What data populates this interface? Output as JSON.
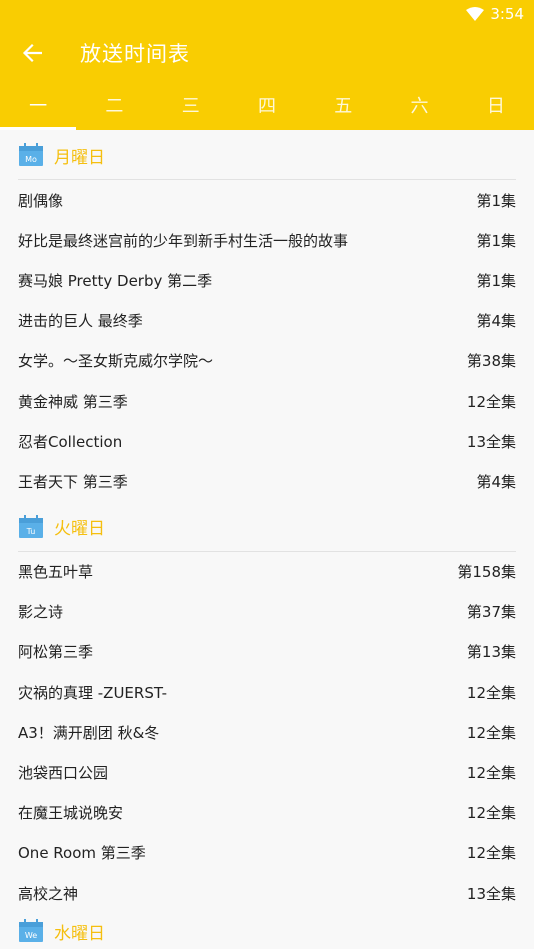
{
  "status": {
    "time": "3:54"
  },
  "toolbar": {
    "title": "放送时间表"
  },
  "tabs": [
    "一",
    "二",
    "三",
    "四",
    "五",
    "六",
    "日"
  ],
  "colors": {
    "appbar": "#f9cd02",
    "section_title": "#f5bf0f",
    "calendar": "#5ab0e8"
  },
  "sections": [
    {
      "icon_label": "Mo",
      "title": "月曜日",
      "items": [
        {
          "name": "剧偶像",
          "ep": "第1集"
        },
        {
          "name": "好比是最终迷宫前的少年到新手村生活一般的故事",
          "ep": "第1集"
        },
        {
          "name": "赛马娘 Pretty Derby 第二季",
          "ep": "第1集"
        },
        {
          "name": "进击的巨人 最终季",
          "ep": "第4集"
        },
        {
          "name": "女学。～圣女斯克威尔学院～",
          "ep": "第38集"
        },
        {
          "name": "黄金神威 第三季",
          "ep": "12全集"
        },
        {
          "name": "忍者Collection",
          "ep": "13全集"
        },
        {
          "name": "王者天下 第三季",
          "ep": "第4集"
        }
      ]
    },
    {
      "icon_label": "Tu",
      "title": "火曜日",
      "items": [
        {
          "name": "黑色五叶草",
          "ep": "第158集"
        },
        {
          "name": "影之诗",
          "ep": "第37集"
        },
        {
          "name": "阿松第三季",
          "ep": "第13集"
        },
        {
          "name": "灾祸的真理 -ZUERST-",
          "ep": "12全集"
        },
        {
          "name": "A3！满开剧团 秋&冬",
          "ep": "12全集"
        },
        {
          "name": "池袋西口公园",
          "ep": "12全集"
        },
        {
          "name": "在魔王城说晚安",
          "ep": "12全集"
        },
        {
          "name": "One Room 第三季",
          "ep": "12全集"
        },
        {
          "name": "高校之神",
          "ep": "13全集"
        }
      ]
    },
    {
      "icon_label": "We",
      "title": "水曜日",
      "items": []
    }
  ]
}
